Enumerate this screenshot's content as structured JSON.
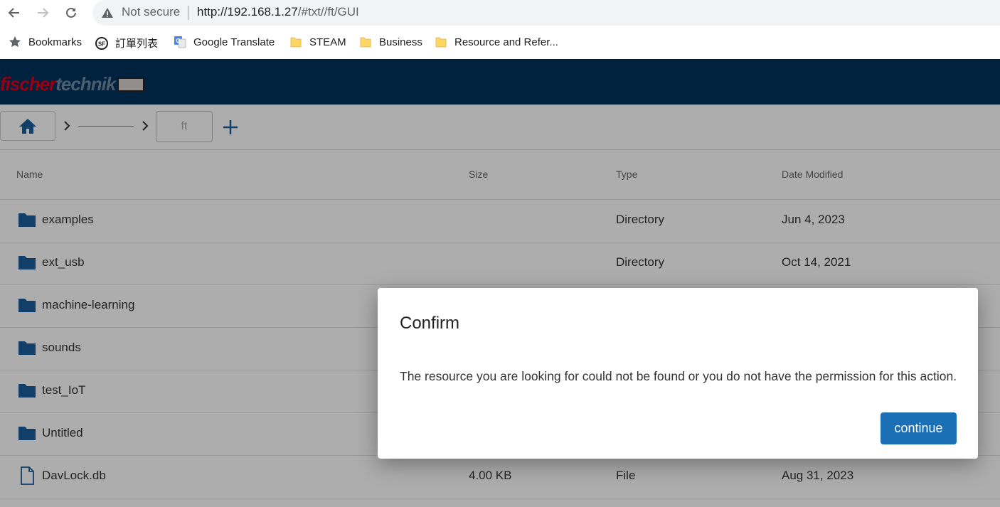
{
  "browser": {
    "security_label": "Not secure",
    "url_host": "http://192.168.1.27",
    "url_path": "/#txt//ft/GUI",
    "bookmarks": [
      {
        "label": "Bookmarks",
        "icon": "star-icon"
      },
      {
        "label": "訂單列表",
        "icon": "sf-logo-icon"
      },
      {
        "label": "Google Translate",
        "icon": "google-translate-icon"
      },
      {
        "label": "STEAM",
        "icon": "folder-icon"
      },
      {
        "label": "Business",
        "icon": "folder-icon"
      },
      {
        "label": "Resource and Refer...",
        "icon": "folder-icon"
      }
    ]
  },
  "app": {
    "logo_part1": "fischer",
    "logo_part2": "technik",
    "brand_color": "#00335c"
  },
  "toolbar": {
    "current_folder": "ft"
  },
  "table": {
    "headers": [
      "Name",
      "Size",
      "Type",
      "Date Modified"
    ],
    "rows": [
      {
        "name": "examples",
        "size": "",
        "type": "Directory",
        "date": "Jun 4, 2023",
        "icon": "folder-icon"
      },
      {
        "name": "ext_usb",
        "size": "",
        "type": "Directory",
        "date": "Oct 14, 2021",
        "icon": "folder-icon"
      },
      {
        "name": "machine-learning",
        "size": "",
        "type": "",
        "date": "",
        "icon": "folder-icon"
      },
      {
        "name": "sounds",
        "size": "",
        "type": "",
        "date": "",
        "icon": "folder-icon"
      },
      {
        "name": "test_IoT",
        "size": "",
        "type": "",
        "date": "",
        "icon": "folder-icon"
      },
      {
        "name": "Untitled",
        "size": "",
        "type": "",
        "date": "",
        "icon": "folder-icon"
      },
      {
        "name": "DavLock.db",
        "size": "4.00 KB",
        "type": "File",
        "date": "Aug 31, 2023",
        "icon": "file-icon"
      }
    ]
  },
  "dialog": {
    "title": "Confirm",
    "message": "The resource you are looking for could not be found or you do not have the permission for this action.",
    "button": "continue",
    "button_color": "#1a6fb5"
  }
}
